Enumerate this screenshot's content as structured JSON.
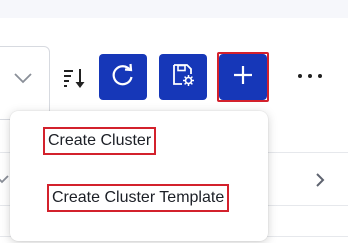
{
  "toolbar": {
    "sort_icon": "sort-descending-icon",
    "refresh_icon": "refresh-icon",
    "save_icon": "save-settings-icon",
    "add_icon": "plus-icon",
    "more_icon": "more-horizontal-icon",
    "accent_color": "#1637b8",
    "highlight_color": "#d3212c"
  },
  "dropdown": {
    "items": [
      {
        "label": "Create Cluster"
      },
      {
        "label": "Create Cluster Template"
      }
    ]
  }
}
